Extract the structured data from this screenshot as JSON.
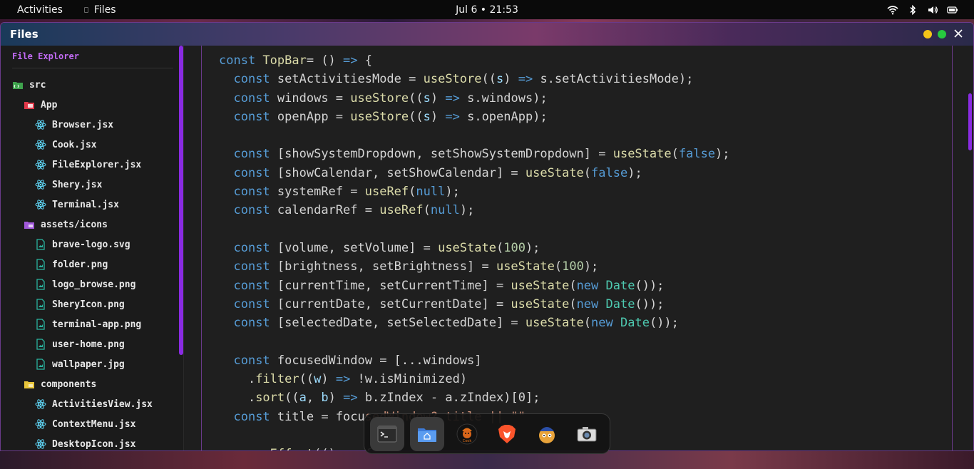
{
  "topbar": {
    "activities": "Activities",
    "app_name": "Files",
    "clock": "Jul 6 • 21:53"
  },
  "window": {
    "title": "Files"
  },
  "sidebar": {
    "heading": "File Explorer",
    "items": [
      {
        "label": "src",
        "type": "folder-src",
        "indent": 0
      },
      {
        "label": "App",
        "type": "folder-app",
        "indent": 1
      },
      {
        "label": "Browser.jsx",
        "type": "react",
        "indent": 2
      },
      {
        "label": "Cook.jsx",
        "type": "react",
        "indent": 2
      },
      {
        "label": "FileExplorer.jsx",
        "type": "react",
        "indent": 2
      },
      {
        "label": "Shery.jsx",
        "type": "react",
        "indent": 2
      },
      {
        "label": "Terminal.jsx",
        "type": "react",
        "indent": 2
      },
      {
        "label": "assets/icons",
        "type": "folder-assets",
        "indent": 1
      },
      {
        "label": "brave-logo.svg",
        "type": "image",
        "indent": 2
      },
      {
        "label": "folder.png",
        "type": "image",
        "indent": 2
      },
      {
        "label": "logo_browse.png",
        "type": "image",
        "indent": 2
      },
      {
        "label": "SheryIcon.png",
        "type": "image",
        "indent": 2
      },
      {
        "label": "terminal-app.png",
        "type": "image",
        "indent": 2
      },
      {
        "label": "user-home.png",
        "type": "image",
        "indent": 2
      },
      {
        "label": "wallpaper.jpg",
        "type": "image",
        "indent": 2
      },
      {
        "label": "components",
        "type": "folder-components",
        "indent": 1
      },
      {
        "label": "ActivitiesView.jsx",
        "type": "react",
        "indent": 2
      },
      {
        "label": "ContextMenu.jsx",
        "type": "react",
        "indent": 2
      },
      {
        "label": "DesktopIcon.jsx",
        "type": "react",
        "indent": 2
      }
    ]
  },
  "editor": {
    "lines": [
      [
        [
          "kw",
          "const "
        ],
        [
          "fn",
          "TopBar"
        ],
        [
          "",
          "= () "
        ],
        [
          "kw",
          "=>"
        ],
        [
          "",
          " {"
        ]
      ],
      [
        [
          "",
          "  "
        ],
        [
          "kw",
          "const "
        ],
        [
          "",
          "setActivitiesMode = "
        ],
        [
          "fn",
          "useStore"
        ],
        [
          "",
          "(("
        ],
        [
          "var",
          "s"
        ],
        [
          ") "
        ],
        [
          "kw",
          "=>"
        ],
        [
          "",
          " s.setActivitiesMode);"
        ]
      ],
      [
        [
          "",
          "  "
        ],
        [
          "kw",
          "const "
        ],
        [
          "",
          "windows = "
        ],
        [
          "fn",
          "useStore"
        ],
        [
          "",
          "(("
        ],
        [
          "var",
          "s"
        ],
        [
          ") "
        ],
        [
          "kw",
          "=>"
        ],
        [
          "",
          " s.windows);"
        ]
      ],
      [
        [
          "",
          "  "
        ],
        [
          "kw",
          "const "
        ],
        [
          "",
          "openApp = "
        ],
        [
          "fn",
          "useStore"
        ],
        [
          "",
          "(("
        ],
        [
          "var",
          "s"
        ],
        [
          ") "
        ],
        [
          "kw",
          "=>"
        ],
        [
          "",
          " s.openApp);"
        ]
      ],
      [
        [
          "",
          ""
        ]
      ],
      [
        [
          "",
          "  "
        ],
        [
          "kw",
          "const "
        ],
        [
          "",
          "[showSystemDropdown, setShowSystemDropdown] = "
        ],
        [
          "fn",
          "useState"
        ],
        [
          "",
          "("
        ],
        [
          "kw",
          "false"
        ],
        [
          "",
          ");"
        ]
      ],
      [
        [
          "",
          "  "
        ],
        [
          "kw",
          "const "
        ],
        [
          "",
          "[showCalendar, setShowCalendar] = "
        ],
        [
          "fn",
          "useState"
        ],
        [
          "",
          "("
        ],
        [
          "kw",
          "false"
        ],
        [
          "",
          ");"
        ]
      ],
      [
        [
          "",
          "  "
        ],
        [
          "kw",
          "const "
        ],
        [
          "",
          "systemRef = "
        ],
        [
          "fn",
          "useRef"
        ],
        [
          "",
          "("
        ],
        [
          "kw",
          "null"
        ],
        [
          "",
          ");"
        ]
      ],
      [
        [
          "",
          "  "
        ],
        [
          "kw",
          "const "
        ],
        [
          "",
          "calendarRef = "
        ],
        [
          "fn",
          "useRef"
        ],
        [
          "",
          "("
        ],
        [
          "kw",
          "null"
        ],
        [
          "",
          ");"
        ]
      ],
      [
        [
          "",
          ""
        ]
      ],
      [
        [
          "",
          "  "
        ],
        [
          "kw",
          "const "
        ],
        [
          "",
          "[volume, setVolume] = "
        ],
        [
          "fn",
          "useState"
        ],
        [
          "",
          "("
        ],
        [
          "num",
          "100"
        ],
        [
          "",
          ");"
        ]
      ],
      [
        [
          "",
          "  "
        ],
        [
          "kw",
          "const "
        ],
        [
          "",
          "[brightness, setBrightness] = "
        ],
        [
          "fn",
          "useState"
        ],
        [
          "",
          "("
        ],
        [
          "num",
          "100"
        ],
        [
          "",
          ");"
        ]
      ],
      [
        [
          "",
          "  "
        ],
        [
          "kw",
          "const "
        ],
        [
          "",
          "[currentTime, setCurrentTime] = "
        ],
        [
          "fn",
          "useState"
        ],
        [
          "",
          "("
        ],
        [
          "kw",
          "new "
        ],
        [
          "cls",
          "Date"
        ],
        [
          "",
          "());"
        ]
      ],
      [
        [
          "",
          "  "
        ],
        [
          "kw",
          "const "
        ],
        [
          "",
          "[currentDate, setCurrentDate] = "
        ],
        [
          "fn",
          "useState"
        ],
        [
          "",
          "("
        ],
        [
          "kw",
          "new "
        ],
        [
          "cls",
          "Date"
        ],
        [
          "",
          "());"
        ]
      ],
      [
        [
          "",
          "  "
        ],
        [
          "kw",
          "const "
        ],
        [
          "",
          "[selectedDate, setSelectedDate] = "
        ],
        [
          "fn",
          "useState"
        ],
        [
          "",
          "("
        ],
        [
          "kw",
          "new "
        ],
        [
          "cls",
          "Date"
        ],
        [
          "",
          "());"
        ]
      ],
      [
        [
          "",
          ""
        ]
      ],
      [
        [
          "",
          "  "
        ],
        [
          "kw",
          "const "
        ],
        [
          "",
          "focusedWindow = [...windows]"
        ]
      ],
      [
        [
          "",
          "    ."
        ],
        [
          "fn",
          "filter"
        ],
        [
          "",
          "(("
        ],
        [
          "var",
          "w"
        ],
        [
          "",
          ") "
        ],
        [
          "kw",
          "=>"
        ],
        [
          "",
          " !w.isMinimized)"
        ]
      ],
      [
        [
          "",
          "    ."
        ],
        [
          "fn",
          "sort"
        ],
        [
          "",
          "(("
        ],
        [
          "var",
          "a"
        ],
        [
          "",
          ", "
        ],
        [
          "var",
          "b"
        ],
        [
          "",
          ") "
        ],
        [
          "kw",
          "=>"
        ],
        [
          "",
          " b.zIndex - a.zIndex)[0];"
        ]
      ],
      [
        [
          "",
          "  "
        ],
        [
          "kw",
          "const "
        ],
        [
          "",
          "title = focu"
        ],
        [
          "str",
          "sedWindow?.title || \"\""
        ]
      ],
      [
        [
          "",
          ""
        ]
      ],
      [
        [
          "",
          "    "
        ],
        [
          "fn",
          "useEffect"
        ],
        [
          "",
          "(() => {"
        ]
      ]
    ]
  },
  "dock": {
    "items": [
      "terminal-icon",
      "files-icon",
      "cook-icon",
      "brave-icon",
      "shery-icon",
      "camera-icon"
    ],
    "active": [
      "terminal-icon",
      "files-icon"
    ],
    "cook_label": "Cook"
  },
  "colors": {
    "accent": "#8a2be2",
    "heading": "#c26bf5",
    "close_yellow": "#f5c518",
    "close_green": "#27c93f"
  }
}
